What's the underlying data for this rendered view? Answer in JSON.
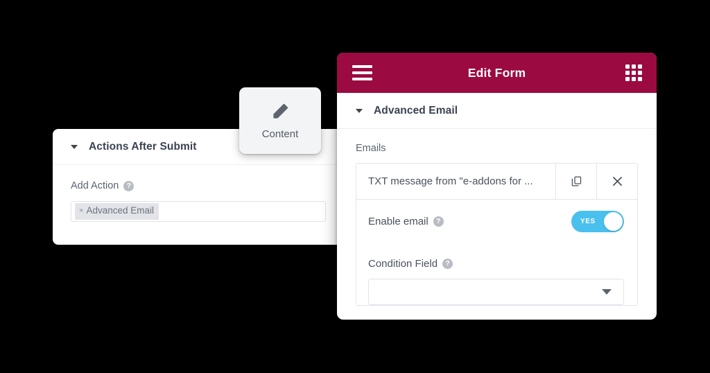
{
  "left_panel": {
    "section_title": "Actions After Submit",
    "collapse_icon": "caret-down-icon",
    "add_action": {
      "label": "Add Action",
      "help_icon": "help-circle-icon",
      "tags": [
        {
          "remove_icon": "×",
          "label": "Advanced Email"
        }
      ]
    }
  },
  "content_tab": {
    "icon": "pencil-icon",
    "label": "Content"
  },
  "right_panel": {
    "topbar": {
      "menu_icon": "hamburger-menu-icon",
      "title": "Edit Form",
      "apps_icon": "apps-grid-icon",
      "background_color": "#9b0a40"
    },
    "section_title": "Advanced Email",
    "collapse_icon": "caret-down-icon",
    "emails": {
      "label": "Emails",
      "items": [
        {
          "title": "TXT message from \"e-addons for ...",
          "duplicate_icon": "copy-icon",
          "remove_icon": "close-x-icon"
        }
      ],
      "enable_email": {
        "label": "Enable email",
        "help_icon": "help-circle-icon",
        "toggle_value": "YES",
        "toggle_on": true,
        "toggle_color": "#49c0ee"
      }
    },
    "condition_field": {
      "label": "Condition Field",
      "help_icon": "help-circle-icon",
      "value": "",
      "placeholder": "",
      "dropdown_icon": "caret-down-icon"
    }
  }
}
